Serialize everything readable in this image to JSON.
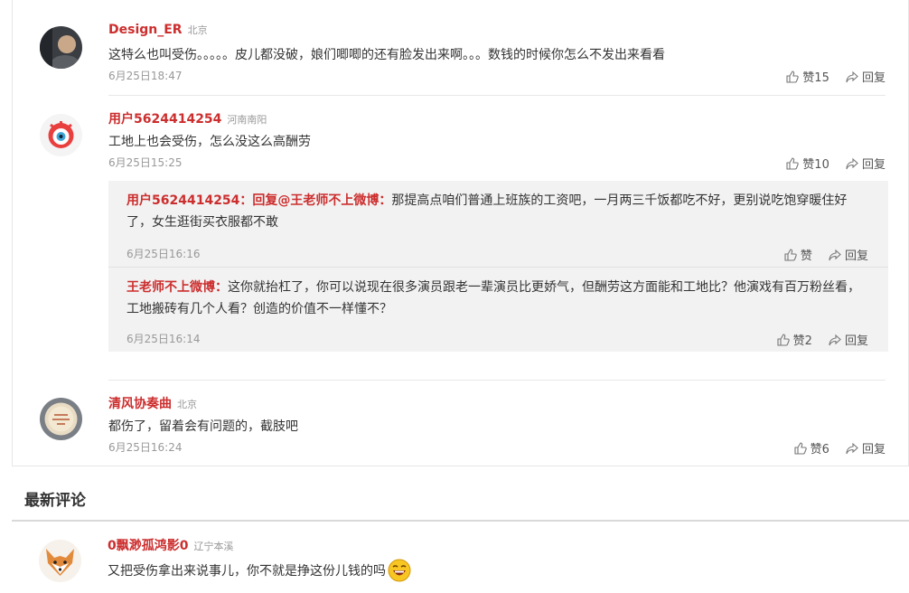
{
  "comments": [
    {
      "user": "Design_ER",
      "location": "北京",
      "text": "这特么也叫受伤。。。。。皮儿都没破，娘们唧唧的还有脸发出来啊。。。数钱的时候你怎么不发出来看看",
      "time": "6月25日18:47",
      "likes": "赞15",
      "reply": "回复"
    },
    {
      "user": "用户5624414254",
      "location": "河南南阳",
      "text": "工地上也会受伤，怎么没这么高酬劳",
      "time": "6月25日15:25",
      "likes": "赞10",
      "reply": "回复",
      "replies": [
        {
          "from": "用户5624414254",
          "mid": "：回复",
          "to": "@王老师不上微博",
          "colon": "：",
          "text": "那提高点咱们普通上班族的工资吧，一月两三千饭都吃不好，更别说吃饱穿暖住好了，女生逛街买衣服都不敢",
          "time": "6月25日16:16",
          "likes": "赞",
          "reply": "回复"
        },
        {
          "from": "王老师不上微博",
          "colon": "：",
          "text": "这你就抬杠了，你可以说现在很多演员跟老一辈演员比更娇气，但酬劳这方面能和工地比？他演戏有百万粉丝看，工地搬砖有几个人看？创造的价值不一样懂不？",
          "time": "6月25日16:14",
          "likes": "赞2",
          "reply": "回复"
        }
      ]
    },
    {
      "user": "清风协奏曲",
      "location": "北京",
      "text": "都伤了，留着会有问题的，截肢吧",
      "time": "6月25日16:24",
      "likes": "赞6",
      "reply": "回复"
    }
  ],
  "latest": {
    "section_title": "最新评论",
    "user": "0飘渺孤鸿影0",
    "location": "辽宁本溪",
    "text": "又把受伤拿出来说事儿，你不就是挣这份儿钱的吗",
    "emoji": "laughing-emoji"
  }
}
